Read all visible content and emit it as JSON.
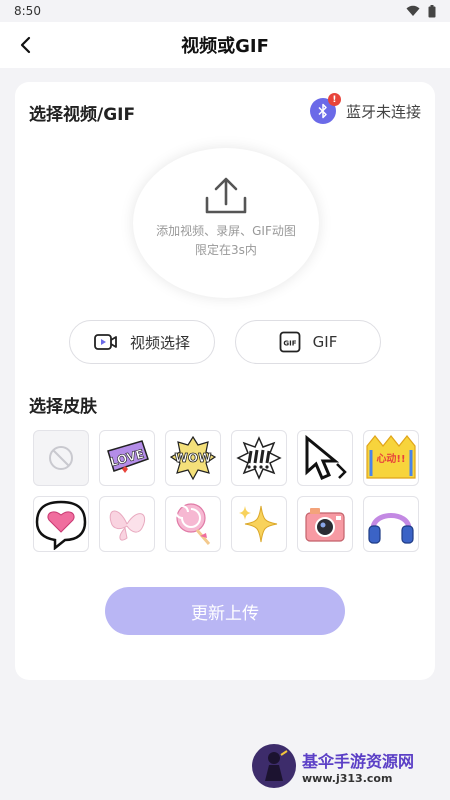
{
  "status_bar": {
    "time": "8:50"
  },
  "app_bar": {
    "title": "视频或GIF"
  },
  "select_section": {
    "title": "选择视频/GIF"
  },
  "bluetooth": {
    "status": "蓝牙未连接",
    "badge": "!",
    "badge_color": "#e8443b",
    "icon_color": "#6b6ae8"
  },
  "upload": {
    "line1": "添加视频、录屏、GIF动图",
    "line2": "限定在3s内"
  },
  "buttons": {
    "video_label": "视频选择",
    "gif_label": "GIF",
    "update_label": "更新上传"
  },
  "skin_section": {
    "title": "选择皮肤",
    "items": [
      {
        "icon": "none-icon"
      },
      {
        "icon": "love-sticker-icon",
        "text": "LOVE"
      },
      {
        "icon": "wow-sticker-icon",
        "text": "WOW"
      },
      {
        "icon": "exclaim-sticker-icon"
      },
      {
        "icon": "cursor-arrow-icon"
      },
      {
        "icon": "crown-sticker-icon",
        "text": "心动!!"
      },
      {
        "icon": "heart-bubble-icon"
      },
      {
        "icon": "butterfly-icon"
      },
      {
        "icon": "lollipop-icon"
      },
      {
        "icon": "sparkle-star-icon"
      },
      {
        "icon": "camera-icon"
      },
      {
        "icon": "headphones-icon"
      }
    ]
  },
  "colors": {
    "accent": "#b9b6f4",
    "brand_purple": "#6b6ae8"
  },
  "watermark": {
    "title": "基伞手游资源网",
    "url": "www.j313.com"
  }
}
